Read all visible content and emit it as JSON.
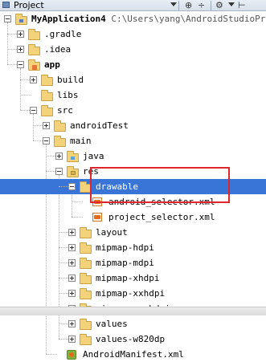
{
  "toolbar": {
    "title": "Project",
    "buttons": [
      "⊕",
      "÷",
      "⚙",
      "⊢"
    ]
  },
  "tree": [
    {
      "label": "MyApplication4",
      "path": "C:\\Users\\yang\\AndroidStudioPro",
      "bold": true,
      "icon": "module-folder-icon",
      "toggle": "minus",
      "expanded": true
    },
    {
      "label": ".gradle",
      "icon": "folder-icon",
      "toggle": "plus"
    },
    {
      "label": ".idea",
      "icon": "folder-icon",
      "toggle": "plus"
    },
    {
      "label": "app",
      "bold": true,
      "icon": "module-folder-icon",
      "toggle": "minus"
    },
    {
      "label": "build",
      "icon": "folder-icon",
      "toggle": "plus"
    },
    {
      "label": "libs",
      "icon": "folder-icon",
      "toggle": "none"
    },
    {
      "label": "src",
      "icon": "folder-icon",
      "toggle": "minus"
    },
    {
      "label": "androidTest",
      "icon": "folder-icon",
      "toggle": "plus"
    },
    {
      "label": "main",
      "icon": "folder-icon",
      "toggle": "minus"
    },
    {
      "label": "java",
      "icon": "source-folder-icon",
      "toggle": "plus"
    },
    {
      "label": "res",
      "icon": "res-folder-icon",
      "toggle": "minus"
    },
    {
      "label": "drawable",
      "icon": "folder-icon",
      "toggle": "minus",
      "selected": true
    },
    {
      "label": "android_selector.xml",
      "icon": "xml-file-icon",
      "toggle": "none"
    },
    {
      "label": "project_selector.xml",
      "icon": "xml-file-icon",
      "toggle": "none"
    },
    {
      "label": "layout",
      "icon": "folder-icon",
      "toggle": "plus"
    },
    {
      "label": "mipmap-hdpi",
      "icon": "folder-icon",
      "toggle": "plus"
    },
    {
      "label": "mipmap-mdpi",
      "icon": "folder-icon",
      "toggle": "plus"
    },
    {
      "label": "mipmap-xhdpi",
      "icon": "folder-icon",
      "toggle": "plus"
    },
    {
      "label": "mipmap-xxhdpi",
      "icon": "folder-icon",
      "toggle": "plus"
    },
    {
      "label": "mipmap-xxxhdpi",
      "icon": "folder-icon",
      "toggle": "plus"
    },
    {
      "label": "values",
      "icon": "folder-icon",
      "toggle": "plus"
    },
    {
      "label": "values-w820dp",
      "icon": "folder-icon",
      "toggle": "plus"
    },
    {
      "label": "AndroidManifest.xml",
      "icon": "manifest-file-icon",
      "toggle": "none"
    }
  ],
  "annotation_color": "#e0262d",
  "selection_color": "#3875d7"
}
